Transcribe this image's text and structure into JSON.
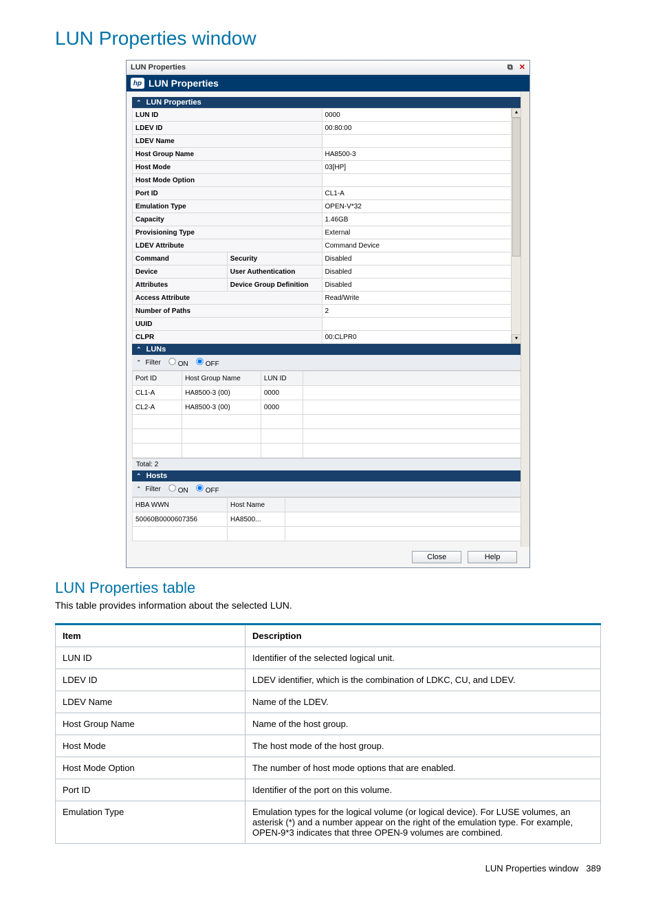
{
  "page": {
    "title": "LUN Properties window",
    "sub_title": "LUN Properties table",
    "intro": "This table provides information about the selected LUN.",
    "footer": "LUN Properties window",
    "page_number": "389"
  },
  "win": {
    "titlebar": "LUN Properties",
    "subheader": "LUN Properties",
    "section_props": "LUN Properties",
    "section_luns": "LUNs",
    "section_hosts": "Hosts",
    "filter_label": "Filter",
    "on": "ON",
    "off": "OFF",
    "total_label": "Total:",
    "close": "Close",
    "help": "Help"
  },
  "props": {
    "rows": [
      {
        "label": "LUN ID",
        "sub": "",
        "value": "0000"
      },
      {
        "label": "LDEV ID",
        "sub": "",
        "value": "00:80:00"
      },
      {
        "label": "LDEV Name",
        "sub": "",
        "value": ""
      },
      {
        "label": "Host Group Name",
        "sub": "",
        "value": "HA8500-3"
      },
      {
        "label": "Host Mode",
        "sub": "",
        "value": "03[HP]"
      },
      {
        "label": "Host Mode Option",
        "sub": "",
        "value": ""
      },
      {
        "label": "Port ID",
        "sub": "",
        "value": "CL1-A"
      },
      {
        "label": "Emulation Type",
        "sub": "",
        "value": "OPEN-V*32"
      },
      {
        "label": "Capacity",
        "sub": "",
        "value": "1.46GB"
      },
      {
        "label": "Provisioning Type",
        "sub": "",
        "value": "External"
      },
      {
        "label": "LDEV Attribute",
        "sub": "",
        "value": "Command Device"
      },
      {
        "label": "Command",
        "sub": "Security",
        "value": "Disabled"
      },
      {
        "label": "Device",
        "sub": "User Authentication",
        "value": "Disabled"
      },
      {
        "label": "Attributes",
        "sub": "Device Group Definition",
        "value": "Disabled"
      },
      {
        "label": "Access Attribute",
        "sub": "",
        "value": "Read/Write"
      },
      {
        "label": "Number of Paths",
        "sub": "",
        "value": "2"
      },
      {
        "label": "UUID",
        "sub": "",
        "value": ""
      },
      {
        "label": "CLPR",
        "sub": "",
        "value": "00:CLPR0"
      }
    ]
  },
  "luns": {
    "headers": [
      "Port ID",
      "Host Group Name",
      "LUN ID"
    ],
    "rows": [
      [
        "CL1-A",
        "HA8500-3 (00)",
        "0000"
      ],
      [
        "CL2-A",
        "HA8500-3 (00)",
        "0000"
      ]
    ],
    "total": "2"
  },
  "hosts": {
    "headers": [
      "HBA WWN",
      "Host Name"
    ],
    "rows": [
      [
        "50060B0000607356",
        "HA8500..."
      ]
    ]
  },
  "desc": {
    "col1": "Item",
    "col2": "Description",
    "rows": [
      {
        "item": "LUN ID",
        "desc": "Identifier of the selected logical unit."
      },
      {
        "item": "LDEV ID",
        "desc": "LDEV identifier, which is the combination of LDKC, CU, and LDEV."
      },
      {
        "item": "LDEV Name",
        "desc": "Name of the LDEV."
      },
      {
        "item": "Host Group Name",
        "desc": "Name of the host group."
      },
      {
        "item": "Host Mode",
        "desc": "The host mode of the host group."
      },
      {
        "item": "Host Mode Option",
        "desc": "The number of host mode options that are enabled."
      },
      {
        "item": "Port ID",
        "desc": "Identifier of the port on this volume."
      },
      {
        "item": "Emulation Type",
        "desc": "Emulation types for the logical volume (or logical device). For LUSE volumes, an asterisk (*) and a number appear on the right of the emulation type. For example, OPEN-9*3 indicates that three OPEN-9 volumes are combined."
      }
    ]
  }
}
